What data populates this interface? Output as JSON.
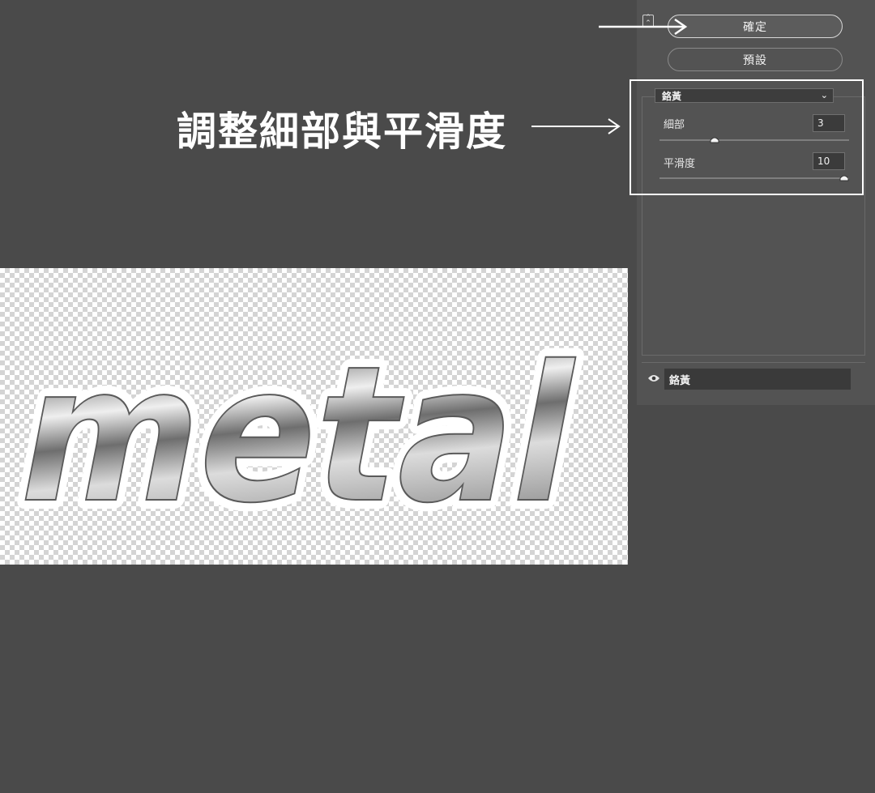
{
  "dialog": {
    "ok_label": "確定",
    "preset_label": "預設",
    "effect_selected": "鉻黃",
    "params": [
      {
        "label": "細部",
        "value": "3",
        "level": 0.3
      },
      {
        "label": "平滑度",
        "value": "10",
        "level": 1.0
      }
    ]
  },
  "layers": [
    {
      "name": "鉻黃",
      "visible": true
    }
  ],
  "annotation": {
    "text": "調整細部與平滑度"
  },
  "canvas": {
    "text": "metal"
  },
  "colors": {
    "workspace": "#4a4a4a",
    "panel": "#535353",
    "highlight": "#ffffff"
  }
}
